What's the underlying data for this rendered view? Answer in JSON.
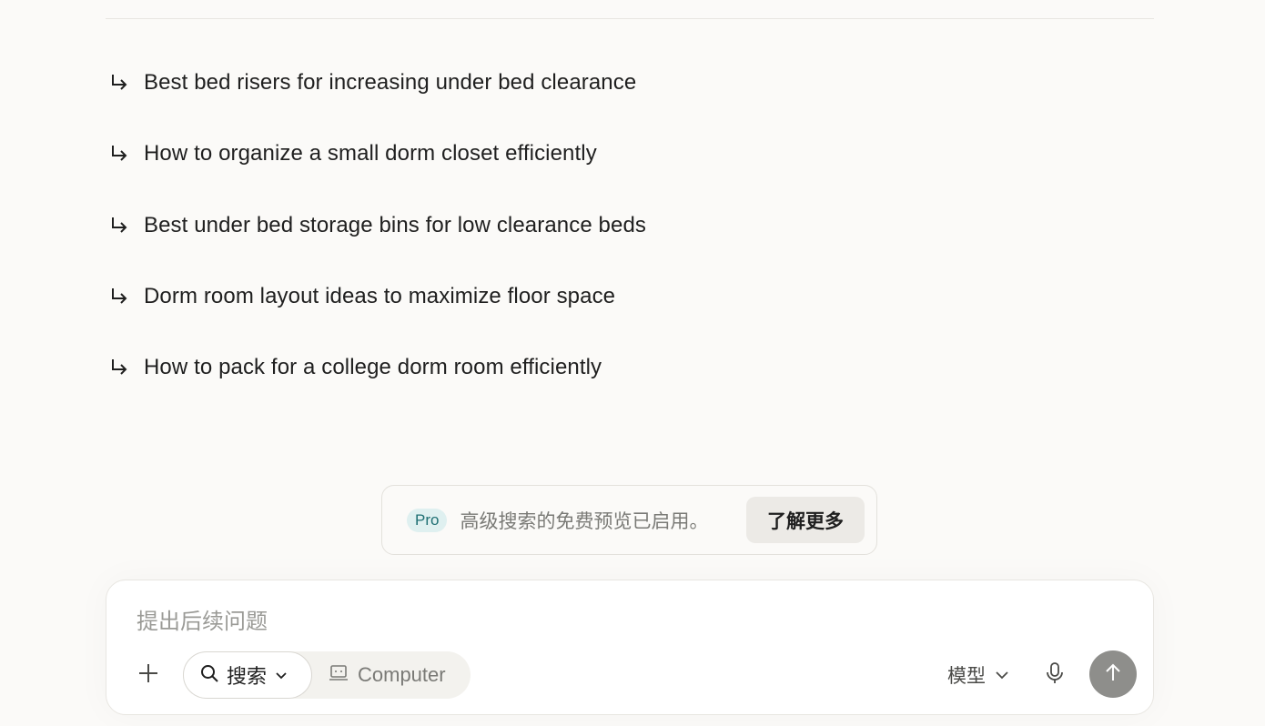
{
  "related": {
    "items": [
      {
        "label": "Best bed risers for increasing under bed clearance"
      },
      {
        "label": "How to organize a small dorm closet efficiently"
      },
      {
        "label": "Best under bed storage bins for low clearance beds"
      },
      {
        "label": "Dorm room layout ideas to maximize floor space"
      },
      {
        "label": "How to pack for a college dorm room efficiently"
      }
    ],
    "icon": "return-arrow-icon"
  },
  "pro_banner": {
    "badge": "Pro",
    "message": "高级搜索的免费预览已启用。",
    "learn_more_label": "了解更多"
  },
  "composer": {
    "placeholder": "提出后续问题",
    "value": "",
    "attach_icon": "plus-icon",
    "modes": {
      "search_label": "搜索",
      "computer_label": "Computer",
      "selected": "搜索"
    },
    "model_label": "模型",
    "mic_icon": "microphone-icon",
    "send_icon": "arrow-up-icon"
  },
  "colors": {
    "background": "#fbfaf8",
    "pro_badge_bg": "#dff0f0",
    "pro_badge_text": "#1f6f73",
    "send_button": "#8e8e8b"
  }
}
